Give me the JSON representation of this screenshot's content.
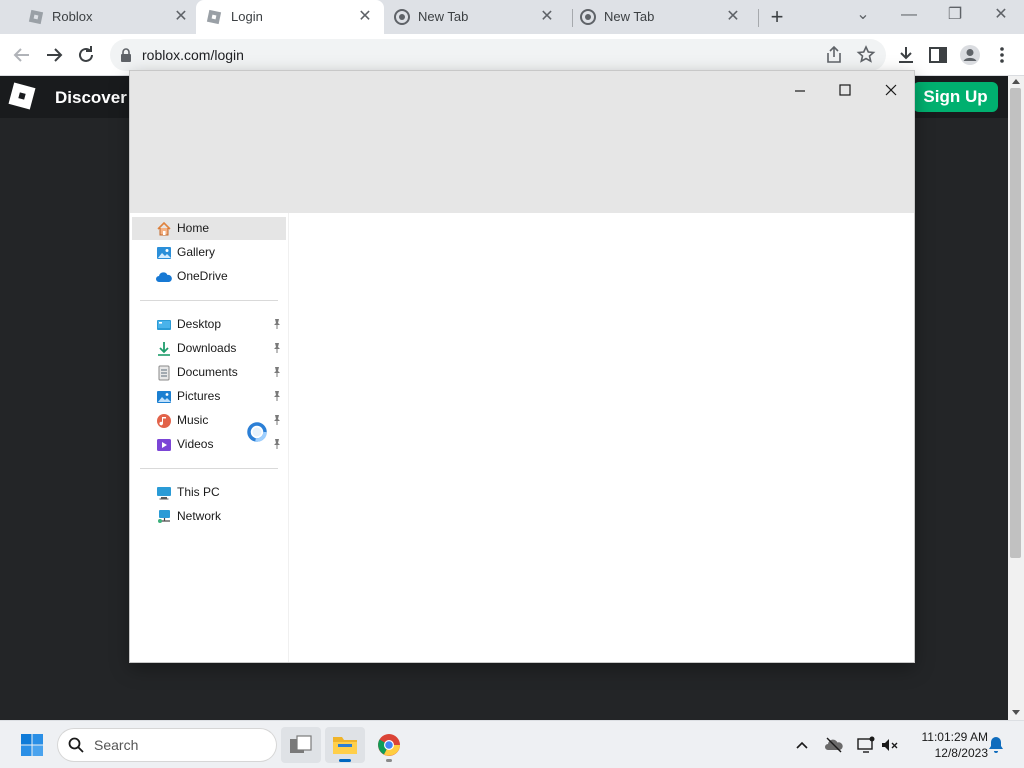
{
  "browser": {
    "tabs": [
      {
        "title": "Roblox",
        "icon": "roblox-favicon",
        "active": false
      },
      {
        "title": "Login",
        "icon": "roblox-favicon",
        "active": true
      },
      {
        "title": "New Tab",
        "icon": "chrome-icon",
        "active": false
      },
      {
        "title": "New Tab",
        "icon": "chrome-icon",
        "active": false
      }
    ],
    "new_tab_label": "+",
    "url": "roblox.com/login"
  },
  "roblox": {
    "discover_label": "Discover",
    "signup_label": "Sign Up",
    "accent_color": "#00b06f"
  },
  "explorer": {
    "nav_quick": [
      {
        "label": "Home",
        "icon": "home-icon",
        "selected": true
      },
      {
        "label": "Gallery",
        "icon": "gallery-icon"
      },
      {
        "label": "OneDrive",
        "icon": "onedrive-icon"
      }
    ],
    "nav_pinned": [
      {
        "label": "Desktop",
        "icon": "desktop-icon"
      },
      {
        "label": "Downloads",
        "icon": "download-icon"
      },
      {
        "label": "Documents",
        "icon": "documents-icon"
      },
      {
        "label": "Pictures",
        "icon": "pictures-icon"
      },
      {
        "label": "Music",
        "icon": "music-icon"
      },
      {
        "label": "Videos",
        "icon": "videos-icon"
      }
    ],
    "nav_devices": [
      {
        "label": "This PC",
        "icon": "this-pc-icon"
      },
      {
        "label": "Network",
        "icon": "network-icon"
      }
    ]
  },
  "taskbar": {
    "search_placeholder": "Search",
    "time": "11:01:29 AM",
    "date": "12/8/2023"
  }
}
